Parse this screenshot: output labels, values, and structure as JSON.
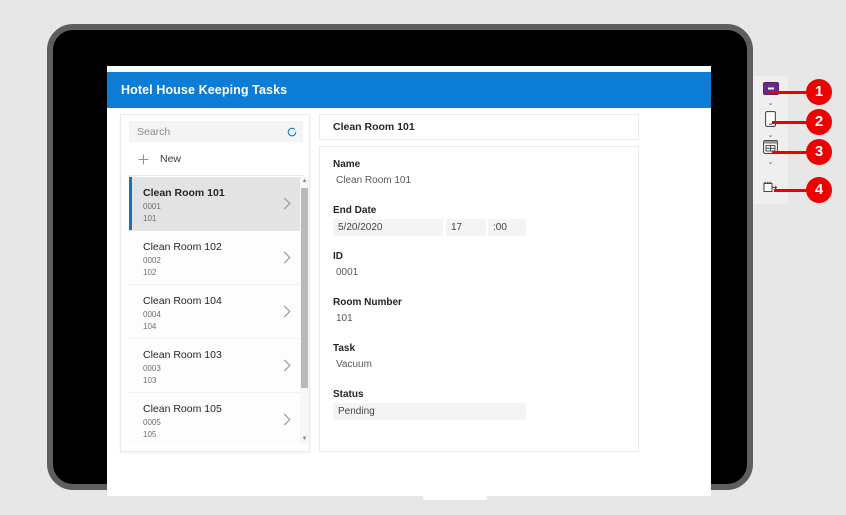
{
  "app": {
    "title": "Hotel House Keeping Tasks",
    "header_color": "#0c7cd5"
  },
  "browse": {
    "search": {
      "placeholder": "Search",
      "value": "",
      "refresh_icon": "refresh-icon"
    },
    "new_button": {
      "label": "New",
      "icon": "plus-icon"
    },
    "items": [
      {
        "title": "Clean Room 101",
        "id": "0001",
        "room": "101",
        "selected": true
      },
      {
        "title": "Clean Room 102",
        "id": "0002",
        "room": "102",
        "selected": false
      },
      {
        "title": "Clean Room 104",
        "id": "0004",
        "room": "104",
        "selected": false
      },
      {
        "title": "Clean Room 103",
        "id": "0003",
        "room": "103",
        "selected": false
      },
      {
        "title": "Clean Room 105",
        "id": "0005",
        "room": "105",
        "selected": false
      }
    ],
    "scrollbar": {
      "up_arrow": "▲",
      "down_arrow": "▼"
    }
  },
  "detail": {
    "title": "Clean Room 101",
    "fields": [
      {
        "label": "Name",
        "value": "Clean Room 101"
      },
      {
        "label": "End Date",
        "date": "5/20/2020",
        "hour": "17",
        "minute": ":00"
      },
      {
        "label": "ID",
        "value": "0001"
      },
      {
        "label": "Room Number",
        "value": "101"
      },
      {
        "label": "Task",
        "value": "Vacuum"
      },
      {
        "label": "Status",
        "value": "Pending"
      }
    ]
  },
  "rail": {
    "items": [
      {
        "icon": "screen-icon",
        "caret": "⌄"
      },
      {
        "icon": "phone-icon",
        "caret": "⌄"
      },
      {
        "icon": "form-icon",
        "caret": "⌄"
      },
      {
        "icon": "edit-form-icon",
        "caret": ""
      }
    ]
  },
  "callouts": [
    {
      "number": "1"
    },
    {
      "number": "2"
    },
    {
      "number": "3"
    },
    {
      "number": "4"
    }
  ],
  "colors": {
    "accent_blue": "#0c7cd5",
    "callout_red": "#ee0000",
    "selected_row": "#e3e3e3",
    "icon_purple": "#6a2a88"
  }
}
